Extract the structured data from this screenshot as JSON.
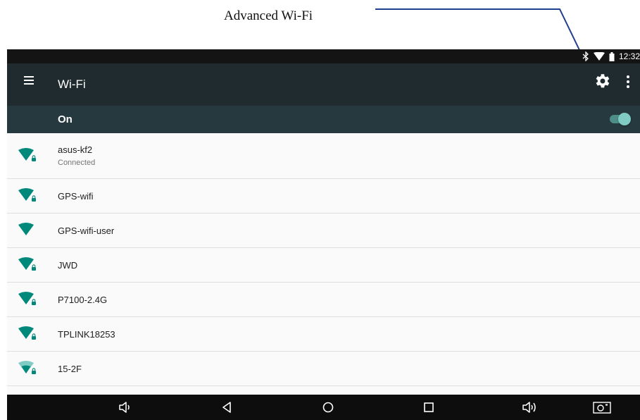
{
  "callout": {
    "label": "Advanced Wi-Fi"
  },
  "status_bar": {
    "time": "12:32",
    "icons": [
      "bluetooth-icon",
      "wifi-signal-icon",
      "battery-icon"
    ]
  },
  "app_bar": {
    "title": "Wi-Fi",
    "icons": [
      "menu-icon",
      "gear-icon",
      "more-vert-icon"
    ]
  },
  "switch_bar": {
    "label": "On",
    "state": "on",
    "accent": "#80cbc4"
  },
  "networks": [
    {
      "ssid": "asus-kf2",
      "status": "Connected",
      "secured": true,
      "signal": "full"
    },
    {
      "ssid": "GPS-wifi",
      "status": "",
      "secured": true,
      "signal": "full"
    },
    {
      "ssid": "GPS-wifi-user",
      "status": "",
      "secured": false,
      "signal": "full"
    },
    {
      "ssid": "JWD",
      "status": "",
      "secured": true,
      "signal": "full"
    },
    {
      "ssid": "P7100-2.4G",
      "status": "",
      "secured": true,
      "signal": "full"
    },
    {
      "ssid": "TPLINK18253",
      "status": "",
      "secured": true,
      "signal": "full"
    },
    {
      "ssid": "15-2F",
      "status": "",
      "secured": true,
      "signal": "medium"
    }
  ],
  "nav_bar": {
    "icons": [
      "volume-down-icon",
      "back-icon",
      "home-icon",
      "recents-icon",
      "volume-up-icon",
      "screenshot-icon"
    ]
  },
  "colors": {
    "wifi": "#00897b",
    "wifi_weak": "#80cbc4",
    "appbar": "#1f2b2f",
    "switchbar": "#25393f"
  }
}
